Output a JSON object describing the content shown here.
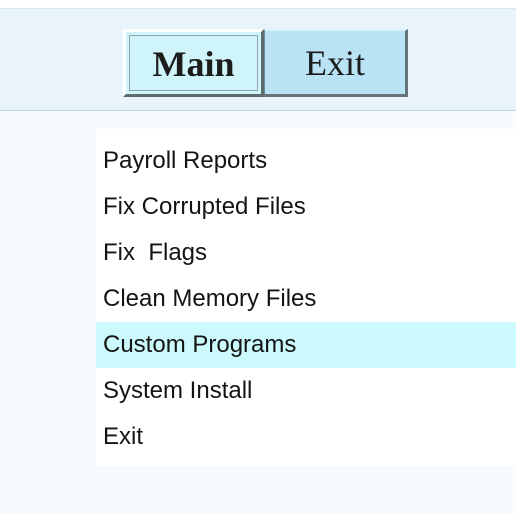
{
  "colors": {
    "toolbar_background": "#e8f4f9",
    "active_tab": "#cff5fb",
    "inactive_tab": "#b9e2f5",
    "highlighted_item": "#ccfafc"
  },
  "toolbar": {
    "tabs": [
      {
        "label": "Main",
        "active": true
      },
      {
        "label": "Exit",
        "active": false
      }
    ]
  },
  "menu": {
    "items": [
      {
        "label": "Payroll Reports",
        "highlighted": false
      },
      {
        "label": "Fix Corrupted Files",
        "highlighted": false
      },
      {
        "label": "Fix  Flags",
        "highlighted": false
      },
      {
        "label": "Clean Memory Files",
        "highlighted": false
      },
      {
        "label": "Custom Programs",
        "highlighted": true
      },
      {
        "label": "System Install",
        "highlighted": false
      },
      {
        "label": "Exit",
        "highlighted": false
      }
    ]
  }
}
